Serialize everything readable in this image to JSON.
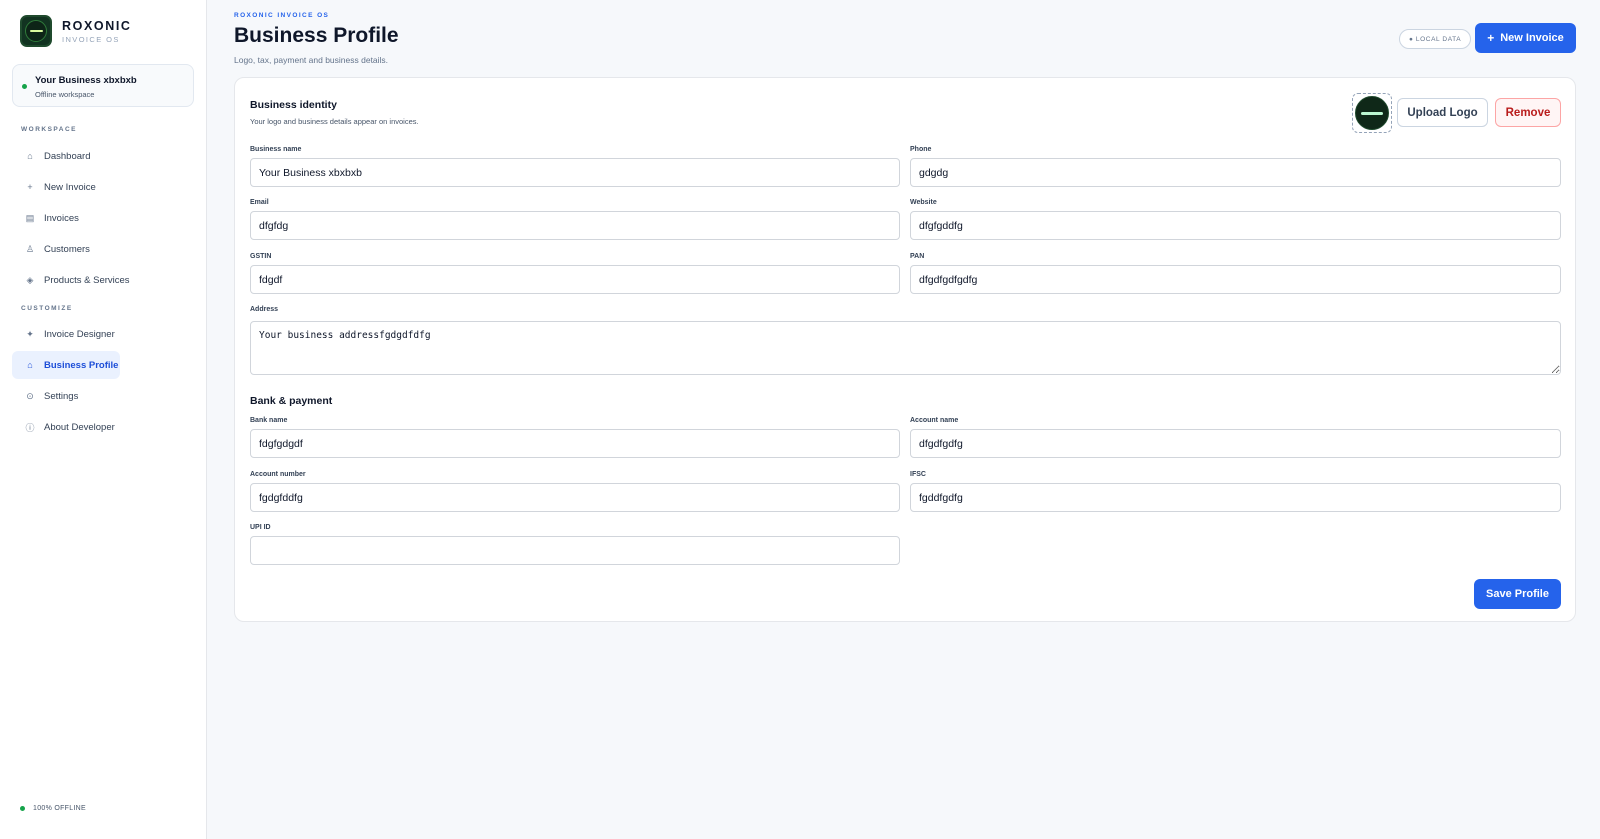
{
  "brand": {
    "name": "ROXONIC",
    "subtitle": "INVOICE OS",
    "logo_icon": "roxonic-logo"
  },
  "business_card": {
    "name": "Your Business xbxbxb",
    "status": "Offline workspace"
  },
  "sidebar": {
    "sections": [
      "WORKSPACE",
      "CUSTOMIZE"
    ],
    "items": [
      {
        "label": "Dashboard",
        "icon": "home-icon",
        "glyph": "⌂"
      },
      {
        "label": "New Invoice",
        "icon": "plus-icon",
        "glyph": "+"
      },
      {
        "label": "Invoices",
        "icon": "list-icon",
        "glyph": "▤"
      },
      {
        "label": "Customers",
        "icon": "user-icon",
        "glyph": "♙"
      },
      {
        "label": "Products & Services",
        "icon": "box-icon",
        "glyph": "◈"
      },
      {
        "label": "Invoice Designer",
        "icon": "sparkle-icon",
        "glyph": "✦"
      },
      {
        "label": "Business Profile",
        "icon": "home-icon",
        "glyph": "⌂",
        "active": true
      },
      {
        "label": "Settings",
        "icon": "gear-icon",
        "glyph": "⊙"
      },
      {
        "label": "About Developer",
        "icon": "info-icon",
        "glyph": "ⓘ"
      }
    ],
    "footer_status": "100% OFFLINE"
  },
  "header": {
    "eyebrow": "ROXONIC INVOICE OS",
    "title": "Business Profile",
    "subtitle": "Logo, tax, payment and business details.",
    "local_badge": "● LOCAL DATA",
    "new_invoice_label": "New Invoice"
  },
  "identity": {
    "title": "Business identity",
    "subtitle": "Your logo and business details appear on invoices.",
    "upload_label": "Upload Logo",
    "remove_label": "Remove"
  },
  "fields": {
    "business_name": {
      "label": "Business name",
      "value": "Your Business xbxbxb"
    },
    "phone": {
      "label": "Phone",
      "value": "gdgdg"
    },
    "email": {
      "label": "Email",
      "value": "dfgfdg"
    },
    "website": {
      "label": "Website",
      "value": "dfgfgddfg"
    },
    "gstin": {
      "label": "GSTIN",
      "value": "fdgdf"
    },
    "pan": {
      "label": "PAN",
      "value": "dfgdfgdfgdfg"
    },
    "address": {
      "label": "Address",
      "value": "Your business addressfgdgdfdfg"
    }
  },
  "bank": {
    "title": "Bank & payment",
    "bank_name": {
      "label": "Bank name",
      "value": "fdgfgdgdf"
    },
    "account_name": {
      "label": "Account name",
      "value": "dfgdfgdfg"
    },
    "account_number": {
      "label": "Account number",
      "value": "fgdgfddfg"
    },
    "ifsc": {
      "label": "IFSC",
      "value": "fgddfgdfg"
    },
    "upi_id": {
      "label": "UPI ID",
      "value": ""
    }
  },
  "save_label": "Save Profile",
  "colors": {
    "accent": "#2563eb",
    "active_bg": "#eaf1fe",
    "danger": "#b91c1c",
    "online": "#16a34a"
  }
}
